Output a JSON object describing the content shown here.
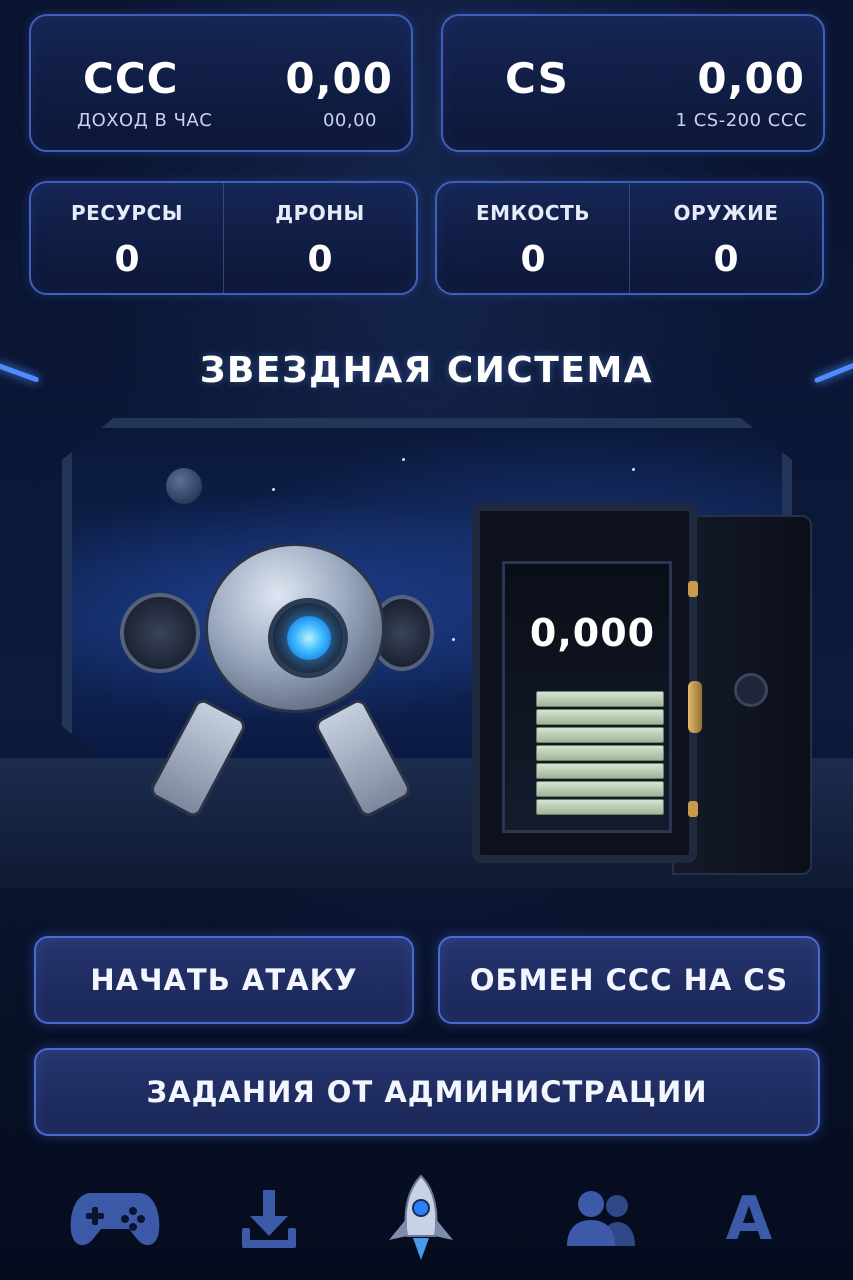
{
  "currencies": {
    "ccc": {
      "code": "CCC",
      "value": "0,00",
      "sub_label": "ДОХОД В ЧАС",
      "sub_value": "00,00"
    },
    "cs": {
      "code": "CS",
      "value": "0,00",
      "sub_value": "1 CS-200 CCC"
    }
  },
  "resources": {
    "resources": {
      "label": "РЕСУРСЫ",
      "value": "0"
    },
    "drones": {
      "label": "ДРОНЫ",
      "value": "0"
    },
    "capacity": {
      "label": "ЕМКОСТЬ",
      "value": "0"
    },
    "weapons": {
      "label": "ОРУЖИЕ",
      "value": "0"
    }
  },
  "section_title": "ЗВЕЗДНАЯ СИСТЕМА",
  "safe": {
    "amount": "0,000"
  },
  "actions": {
    "attack": "НАЧАТЬ АТАКУ",
    "exchange": "ОБМЕН CCC НА CS",
    "tasks": "ЗАДАНИЯ ОТ АДМИНИСТРАЦИИ"
  },
  "nav": {
    "items": [
      {
        "icon": "gamepad-icon"
      },
      {
        "icon": "download-icon"
      },
      {
        "icon": "rocket-icon",
        "active": true
      },
      {
        "icon": "users-icon"
      },
      {
        "icon": "letter-a-icon",
        "letter": "A"
      }
    ]
  },
  "colors": {
    "accent_border": "#3f5fb8",
    "button_fill": "#26356f",
    "nav_icon": "#3d5aa8",
    "drone_eye": "#3ab8ff"
  }
}
